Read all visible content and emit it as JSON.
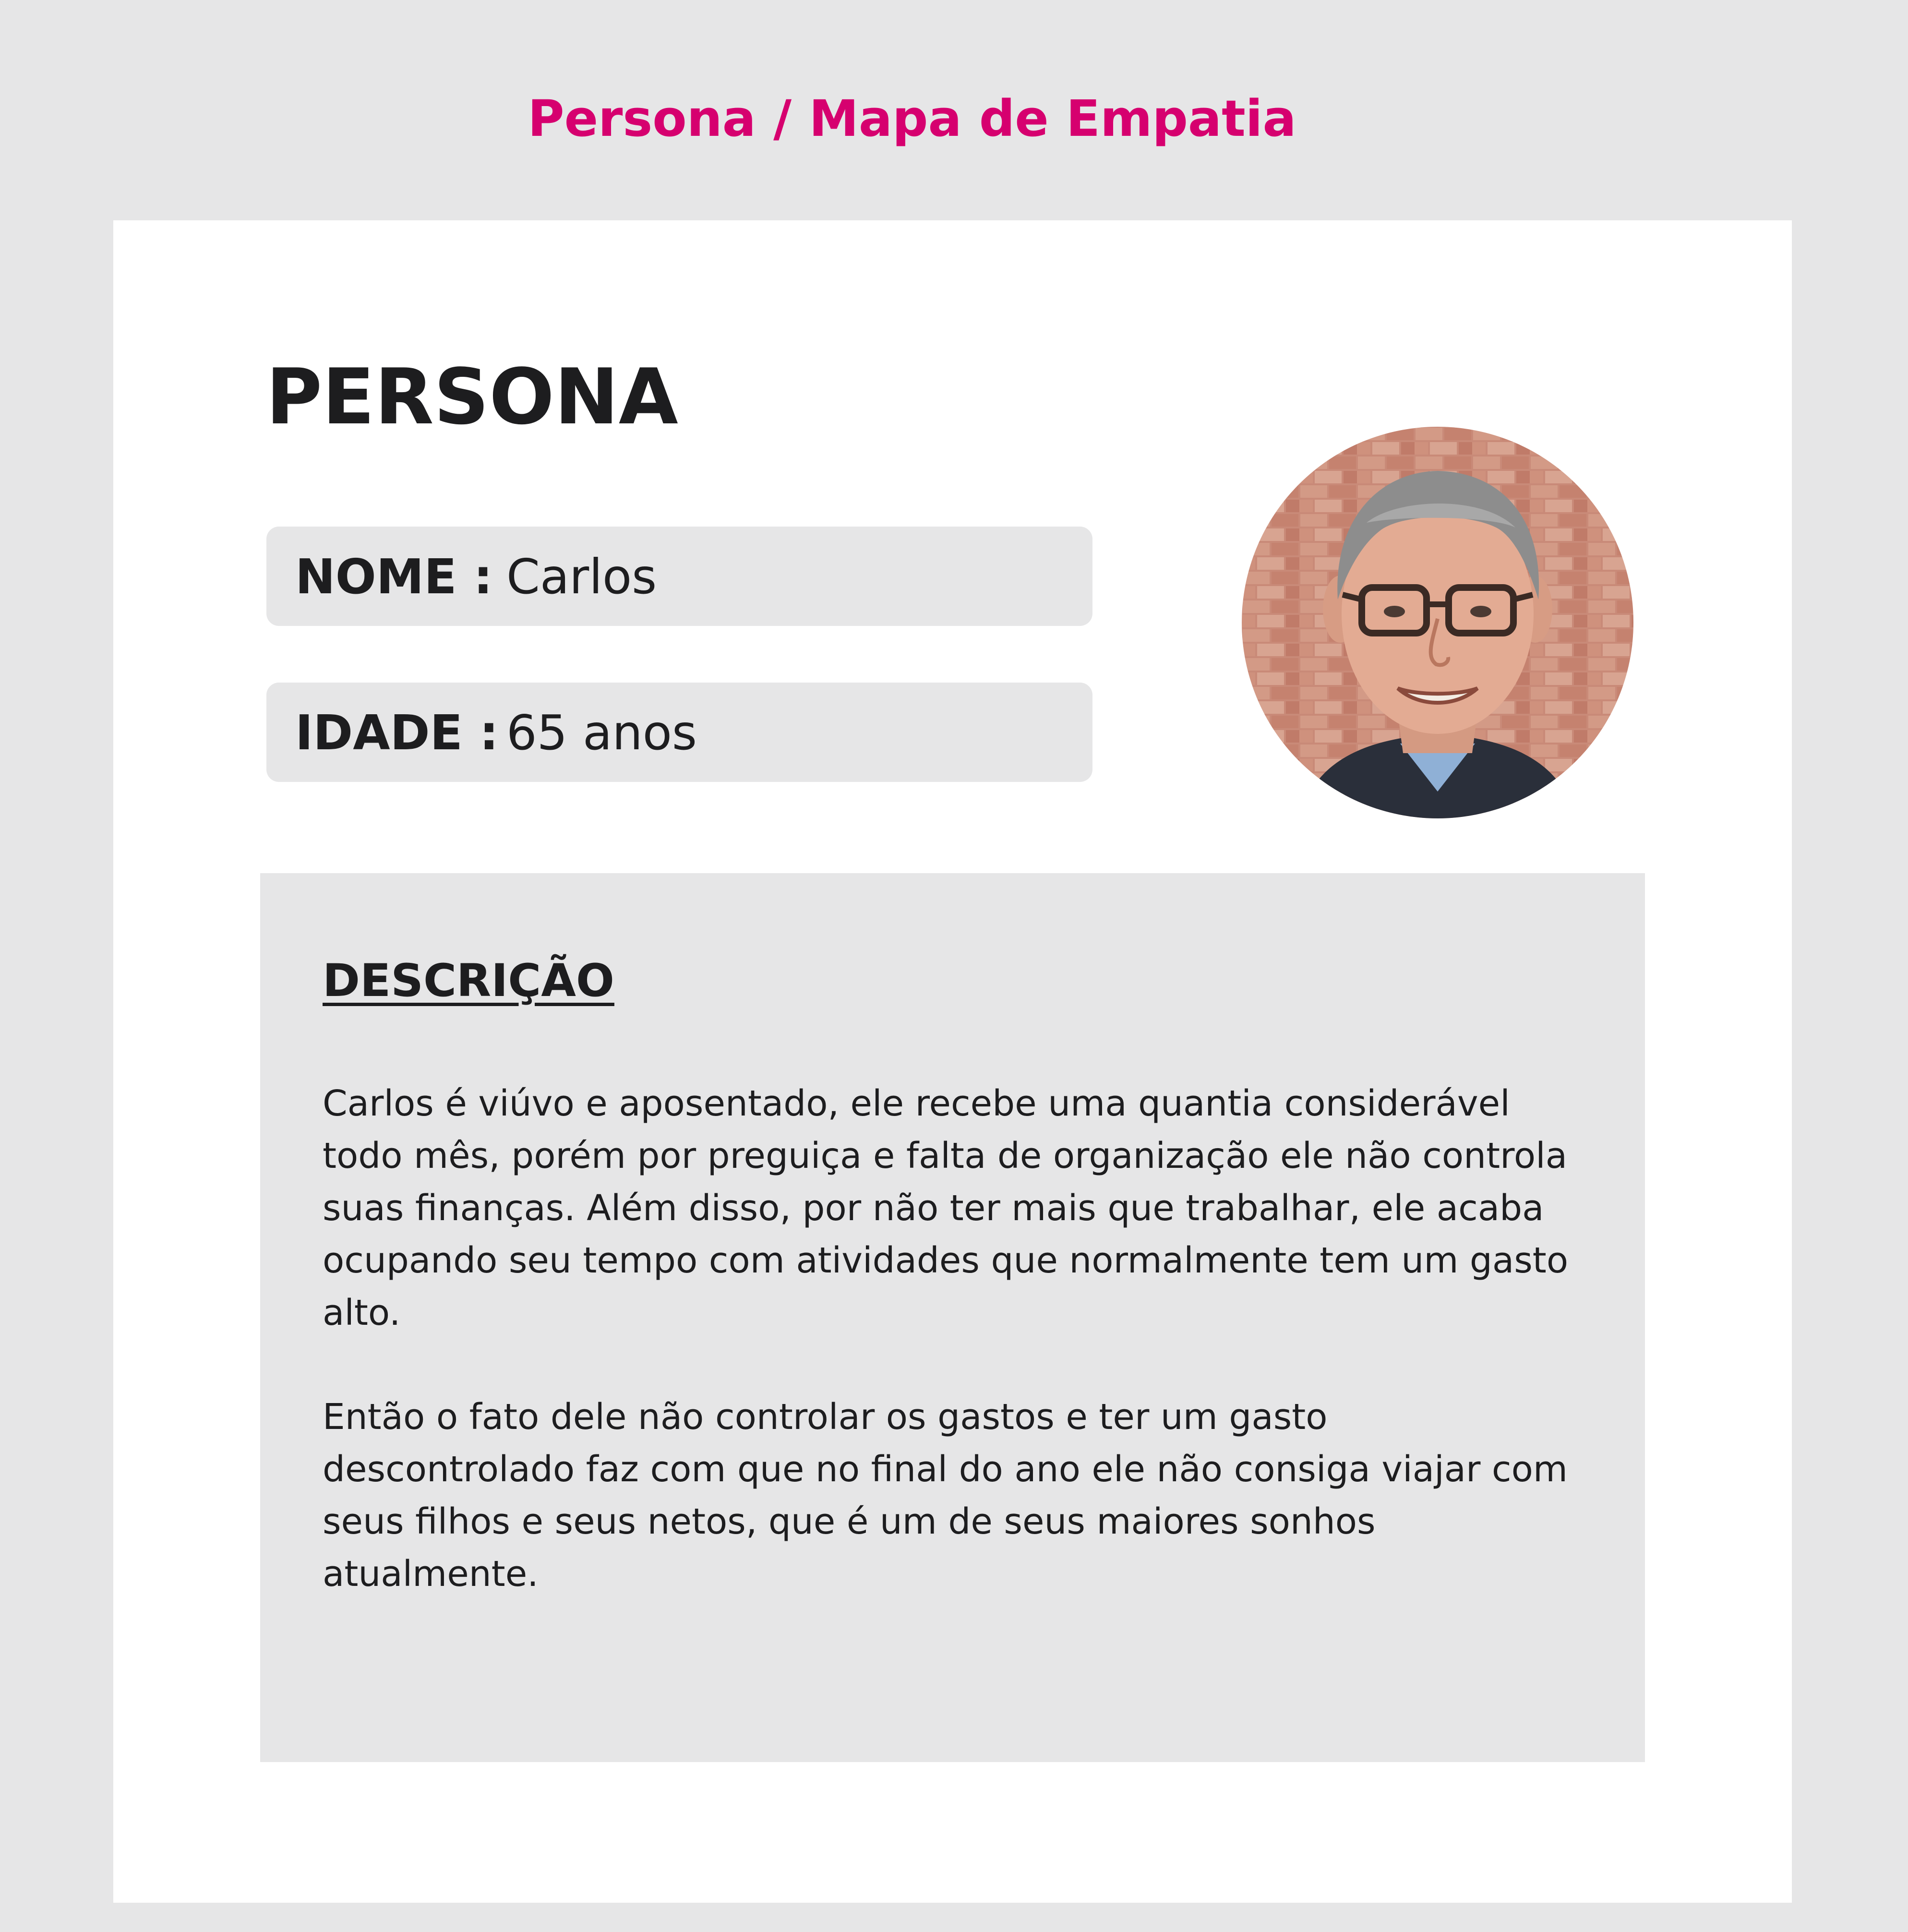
{
  "header": {
    "title": "Persona / Mapa de Empatia"
  },
  "card": {
    "heading": "PERSONA",
    "fields": {
      "name": {
        "label": "NOME  :",
        "value": "Carlos"
      },
      "age": {
        "label": "IDADE :",
        "value": "65 anos"
      }
    },
    "avatar": {
      "icon": "persona-photo-icon"
    },
    "description": {
      "title": "DESCRIÇÃO",
      "paragraphs": [
        "Carlos é viúvo e aposentado, ele recebe uma quantia considerável todo mês, porém por preguiça e falta de organização ele não controla suas finanças. Além disso, por não ter mais que trabalhar, ele acaba ocupando seu tempo com atividades que normalmente tem um gasto alto.",
        "Então o fato dele não controlar os gastos e ter um gasto descontrolado faz com que no final do ano ele não consiga viajar com seus filhos e seus netos, que é um de seus maiores sonhos atualmente."
      ]
    }
  },
  "colors": {
    "page_background": "#e6e6e7",
    "accent": "#d6006f",
    "card_background": "#ffffff",
    "panel_background": "#e6e6e7",
    "text": "#1d1d1f"
  }
}
